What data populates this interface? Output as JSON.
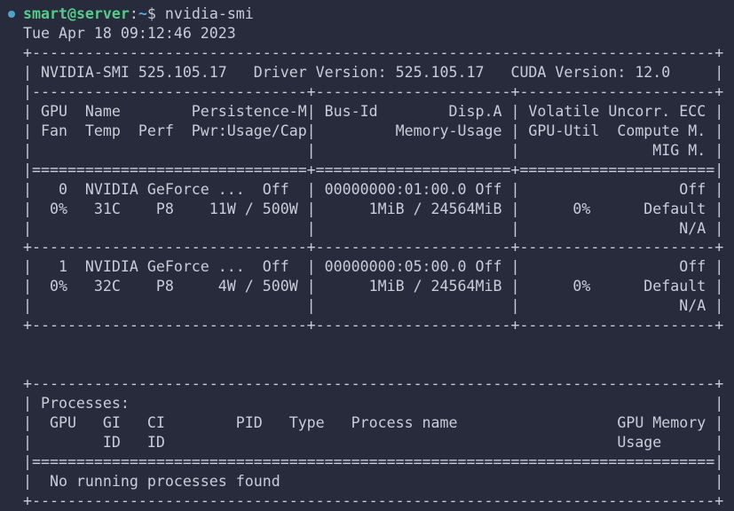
{
  "colors": {
    "background": "#282b3b",
    "text": "#c9ccd9",
    "prompt_user": "#57c98b",
    "prompt_path": "#5aa8de",
    "status_dot": "#4fa3c9"
  },
  "prompt": {
    "status_icon": "circle-dot-icon",
    "user_host": "smart@server",
    "separator": ":",
    "path": "~",
    "symbol": "$",
    "command": " nvidia-smi"
  },
  "output_lines": [
    " Tue Apr 18 09:12:46 2023",
    " +-----------------------------------------------------------------------------+",
    " | NVIDIA-SMI 525.105.17   Driver Version: 525.105.17   CUDA Version: 12.0     |",
    " |-------------------------------+----------------------+----------------------+",
    " | GPU  Name        Persistence-M| Bus-Id        Disp.A | Volatile Uncorr. ECC |",
    " | Fan  Temp  Perf  Pwr:Usage/Cap|         Memory-Usage | GPU-Util  Compute M. |",
    " |                               |                      |               MIG M. |",
    " |===============================+======================+======================|",
    " |   0  NVIDIA GeForce ...  Off  | 00000000:01:00.0 Off |                  Off |",
    " |  0%   31C    P8    11W / 500W |      1MiB / 24564MiB |      0%      Default |",
    " |                               |                      |                  N/A |",
    " +-------------------------------+----------------------+----------------------+",
    " |   1  NVIDIA GeForce ...  Off  | 00000000:05:00.0 Off |                  Off |",
    " |  0%   32C    P8     4W / 500W |      1MiB / 24564MiB |      0%      Default |",
    " |                               |                      |                  N/A |",
    " +-------------------------------+----------------------+----------------------+",
    "",
    "",
    " +-----------------------------------------------------------------------------+",
    " | Processes:                                                                  |",
    " |  GPU   GI   CI        PID   Type   Process name                  GPU Memory |",
    " |        ID   ID                                                   Usage      |",
    " |=============================================================================|",
    " |  No running processes found                                                 |",
    " +-----------------------------------------------------------------------------+"
  ]
}
